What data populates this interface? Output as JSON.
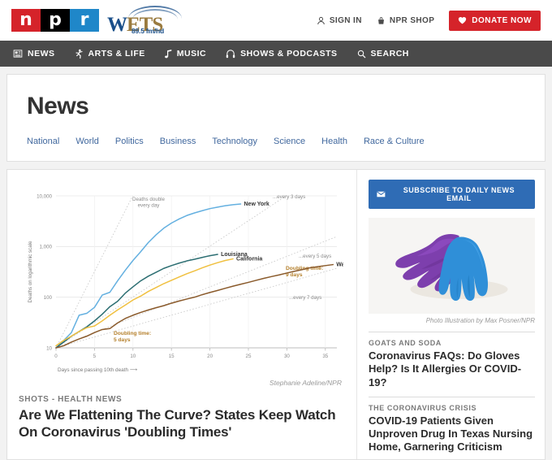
{
  "header": {
    "npr_logo_letters": [
      "n",
      "p",
      "r"
    ],
    "station": {
      "name_w": "W",
      "name_ets": "ETS",
      "tagline": "89.5 fm/hd"
    },
    "utilities": [
      {
        "label": "Sign In",
        "icon": "user-icon"
      },
      {
        "label": "NPR Shop",
        "icon": "shopping-bag-icon"
      }
    ],
    "donate_label": "Donate Now",
    "donate_icon": "heart-icon",
    "donate_color": "#d5232a"
  },
  "nav": {
    "items": [
      {
        "label": "News",
        "icon": "newspaper-icon"
      },
      {
        "label": "Arts & Life",
        "icon": "dancer-icon"
      },
      {
        "label": "Music",
        "icon": "music-note-icon"
      },
      {
        "label": "Shows & Podcasts",
        "icon": "headphones-icon"
      },
      {
        "label": "Search",
        "icon": "search-icon"
      }
    ],
    "background": "#4a4a4a"
  },
  "section": {
    "title": "News",
    "subnav": [
      "National",
      "World",
      "Politics",
      "Business",
      "Technology",
      "Science",
      "Health",
      "Race & Culture"
    ],
    "link_color": "#41689e"
  },
  "main_story": {
    "chart_credit": "Stephanie Adeline/NPR",
    "kicker": "Shots - Health News",
    "headline": "Are We Flattening The Curve? States Keep Watch On Coronavirus 'Doubling Times'"
  },
  "sidebar": {
    "subscribe": {
      "label": "Subscribe to Daily News Email",
      "icon": "envelope-icon",
      "color": "#2f6cb5"
    },
    "photo": {
      "alt": "purple-and-blue-latex-gloves",
      "credit": "Photo Illustration by Max Posner/NPR"
    },
    "stories": [
      {
        "kicker": "Goats and Soda",
        "headline": "Coronavirus FAQs: Do Gloves Help? Is It Allergies Or COVID-19?"
      },
      {
        "kicker": "The Coronavirus Crisis",
        "headline": "COVID-19 Patients Given Unproven Drug In Texas Nursing Home, Garnering Criticism"
      }
    ]
  },
  "chart_data": {
    "type": "line",
    "title": "",
    "xlabel": "Days since passing 10th death ⟶",
    "ylabel": "Deaths on logarithmic scale",
    "yscale": "log",
    "ylim": [
      10,
      10000
    ],
    "xlim": [
      0,
      36.5
    ],
    "yticks": [
      10,
      100,
      1000,
      10000
    ],
    "ytick_labels": [
      "10",
      "100",
      "1,000",
      "10,000"
    ],
    "xticks": [
      0,
      5,
      10,
      15,
      20,
      25,
      30,
      35
    ],
    "xtick_labels": [
      "0",
      "5",
      "10",
      "15",
      "20",
      "25",
      "30",
      "35"
    ],
    "grid": true,
    "legend_position": "inline-end-labels",
    "annotations": [
      {
        "text": "Deaths double every day",
        "lines": [
          "Deaths double",
          "every day"
        ],
        "color": "#8a8a8a"
      },
      {
        "text": "...every 3 days",
        "color": "#8a8a8a"
      },
      {
        "text": "...every 5 days",
        "color": "#8a8a8a"
      },
      {
        "text": "...every 7 days",
        "color": "#8a8a8a"
      },
      {
        "text": "Doubling time: 5 days",
        "lines": [
          "Doubling time:",
          "5 days"
        ],
        "color": "#b5802c"
      },
      {
        "text": "Doubling time: 9 days",
        "lines": [
          "Doubling time:",
          "9 days"
        ],
        "color": "#b5802c"
      }
    ],
    "reference_lines": [
      {
        "name": "every 1 day",
        "doubling_days": 1,
        "style": "dotted"
      },
      {
        "name": "every 3 days",
        "doubling_days": 3,
        "style": "dotted"
      },
      {
        "name": "every 5 days",
        "doubling_days": 5,
        "style": "dotted"
      },
      {
        "name": "every 7 days",
        "doubling_days": 7,
        "style": "dotted"
      }
    ],
    "series": [
      {
        "name": "New York",
        "color": "#64b0e0",
        "label_color": "#333333",
        "x": [
          0,
          1,
          2,
          3,
          4,
          5,
          6,
          7,
          8,
          9,
          10,
          11,
          12,
          13,
          14,
          15,
          16,
          17,
          18,
          19,
          20,
          21,
          22,
          23,
          24
        ],
        "values": [
          10,
          14,
          20,
          44,
          48,
          63,
          110,
          125,
          210,
          340,
          530,
          790,
          1200,
          1700,
          2300,
          2900,
          3500,
          4100,
          4600,
          5100,
          5600,
          6000,
          6400,
          6700,
          6900
        ]
      },
      {
        "name": "Louisiana",
        "color": "#2c6e72",
        "label_color": "#333333",
        "x": [
          0,
          1,
          2,
          3,
          4,
          5,
          6,
          7,
          8,
          9,
          10,
          11,
          12,
          13,
          14,
          15,
          16,
          17,
          18,
          19,
          20,
          21
        ],
        "values": [
          10,
          13,
          17,
          21,
          26,
          34,
          46,
          65,
          83,
          120,
          160,
          210,
          260,
          310,
          370,
          420,
          470,
          520,
          560,
          610,
          660,
          700
        ]
      },
      {
        "name": "California",
        "color": "#f0c040",
        "label_color": "#333333",
        "x": [
          0,
          1,
          2,
          3,
          4,
          5,
          6,
          7,
          8,
          9,
          10,
          11,
          12,
          13,
          14,
          15,
          16,
          17,
          18,
          19,
          20,
          21,
          22,
          23
        ],
        "values": [
          11,
          14,
          17,
          21,
          25,
          27,
          34,
          44,
          56,
          70,
          88,
          105,
          130,
          155,
          185,
          215,
          250,
          290,
          330,
          380,
          430,
          480,
          530,
          570
        ]
      },
      {
        "name": "Washington",
        "color": "#8a5a2b",
        "label_color": "#333333",
        "x": [
          0,
          1,
          2,
          3,
          4,
          5,
          6,
          7,
          8,
          9,
          10,
          11,
          12,
          13,
          14,
          15,
          16,
          17,
          18,
          19,
          20,
          21,
          22,
          23,
          24,
          25,
          26,
          27,
          28,
          29,
          30,
          31,
          32,
          33,
          34,
          35,
          36
        ],
        "values": [
          10,
          11,
          13,
          15,
          17,
          20,
          23,
          24,
          31,
          38,
          44,
          50,
          56,
          62,
          68,
          76,
          84,
          92,
          100,
          112,
          124,
          136,
          150,
          165,
          180,
          196,
          215,
          235,
          255,
          275,
          300,
          325,
          350,
          380,
          400,
          420,
          440
        ]
      }
    ]
  }
}
